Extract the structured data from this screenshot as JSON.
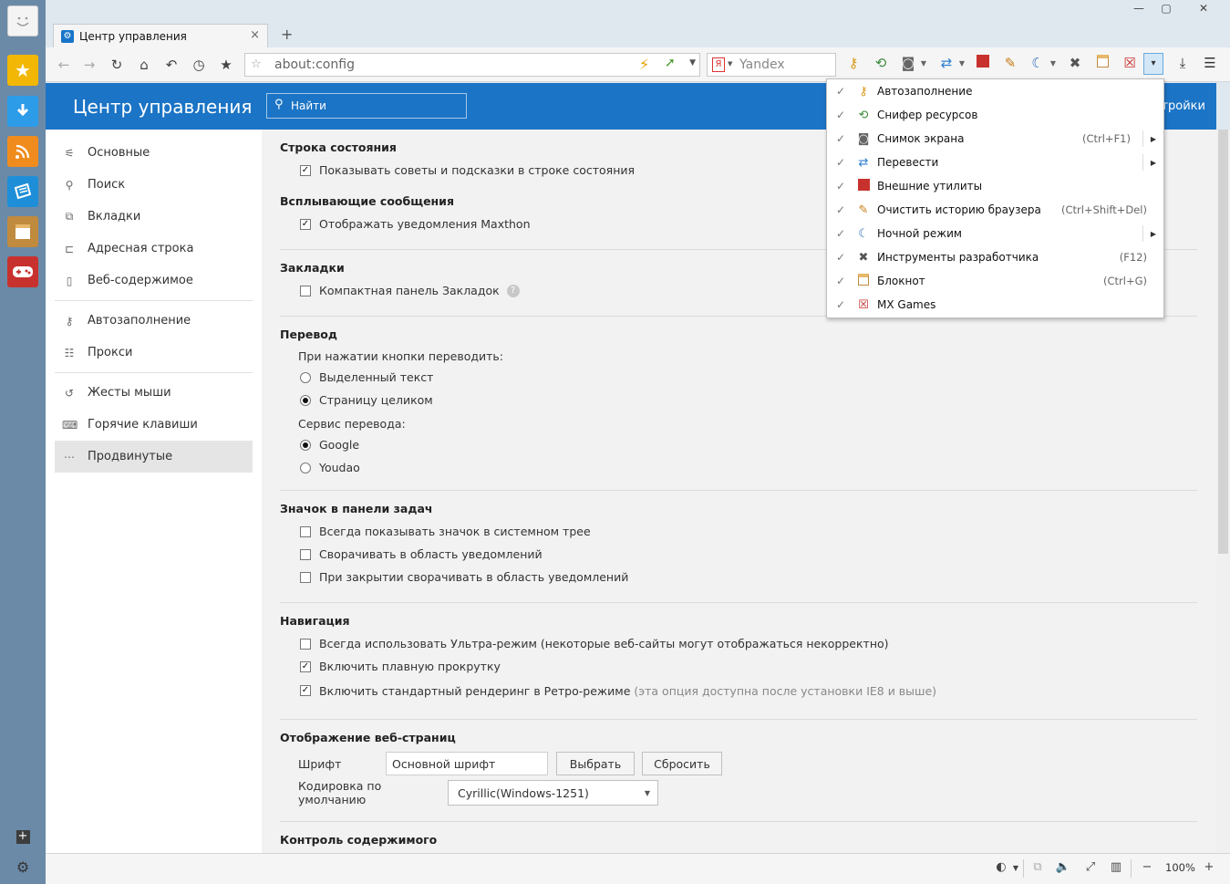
{
  "window": {
    "tab_title": "Центр управления",
    "new_tab": "+",
    "close_tab": "×",
    "minimize": "—",
    "maximize": "▢",
    "close": "✕"
  },
  "toolbar": {
    "url": "about:config",
    "search_engine": "Yandex",
    "search_engine_logo": "Я"
  },
  "header": {
    "title": "Центр управления",
    "search_placeholder": "Найти",
    "right_link": "стройки"
  },
  "nav": {
    "group1": [
      {
        "label": "Основные",
        "icon": "sliders-icon"
      },
      {
        "label": "Поиск",
        "icon": "search-icon"
      },
      {
        "label": "Вкладки",
        "icon": "tabs-icon"
      },
      {
        "label": "Адресная строка",
        "icon": "address-bar-icon"
      },
      {
        "label": "Веб-содержимое",
        "icon": "page-icon"
      }
    ],
    "group2": [
      {
        "label": "Автозаполнение",
        "icon": "key-icon"
      },
      {
        "label": "Прокси",
        "icon": "proxy-icon"
      }
    ],
    "group3": [
      {
        "label": "Жесты мыши",
        "icon": "gesture-icon"
      },
      {
        "label": "Горячие клавиши",
        "icon": "hotkey-icon"
      },
      {
        "label": "Продвинутые",
        "icon": "more-icon",
        "active": true
      }
    ]
  },
  "sections": {
    "status_bar": {
      "title": "Строка состояния",
      "opt1": "Показывать советы и подсказки в строке состояния",
      "opt1_checked": true
    },
    "popups": {
      "title": "Всплывающие сообщения",
      "opt1": "Отображать уведомления Maxthon",
      "opt1_checked": true
    },
    "bookmarks": {
      "title": "Закладки",
      "opt1": "Компактная панель Закладок",
      "opt1_checked": false
    },
    "translate": {
      "title": "Перевод",
      "sub1": "При нажатии кнопки переводить:",
      "r1": "Выделенный текст",
      "r2": "Страницу целиком",
      "sub2": "Сервис перевода:",
      "r3": "Google",
      "r4": "Youdao"
    },
    "tray": {
      "title": "Значок в панели задач",
      "opt1": "Всегда показывать значок в системном трее",
      "opt2": "Сворачивать в область уведомлений",
      "opt3": "При закрытии сворачивать в область уведомлений"
    },
    "navigation": {
      "title": "Навигация",
      "opt1": "Всегда использовать Ультра-режим (некоторые веб-сайты могут отображаться некорректно)",
      "opt2": "Включить плавную прокрутку",
      "opt3": "Включить стандартный рендеринг в Ретро-режиме",
      "opt3_hint": "(эта опция доступна после установки IE8 и выше)"
    },
    "display": {
      "title": "Отображение веб-страниц",
      "font_label": "Шрифт",
      "font_value": "Основной шрифт",
      "choose_btn": "Выбрать",
      "reset_btn": "Сбросить",
      "encoding_label": "Кодировка по умолчанию",
      "encoding_value": "Cyrillic(Windows-1251)"
    },
    "content_control": {
      "title": "Контроль содержимого"
    }
  },
  "menu": {
    "items": [
      {
        "label": "Автозаполнение",
        "icon": "key-icon",
        "shortcut": "",
        "submenu": false
      },
      {
        "label": "Снифер ресурсов",
        "icon": "sniffer-icon",
        "shortcut": "",
        "submenu": false
      },
      {
        "label": "Снимок экрана",
        "icon": "camera-icon",
        "shortcut": "(Ctrl+F1)",
        "submenu": true
      },
      {
        "label": "Перевести",
        "icon": "translate-icon",
        "shortcut": "",
        "submenu": true
      },
      {
        "label": "Внешние утилиты",
        "icon": "external-tools-icon",
        "shortcut": "",
        "submenu": false
      },
      {
        "label": "Очистить историю браузера",
        "icon": "broom-icon",
        "shortcut": "(Ctrl+Shift+Del)",
        "submenu": false
      },
      {
        "label": "Ночной режим",
        "icon": "moon-icon",
        "shortcut": "",
        "submenu": true
      },
      {
        "label": "Инструменты разработчика",
        "icon": "wrench-icon",
        "shortcut": "(F12)",
        "submenu": false
      },
      {
        "label": "Блокнот",
        "icon": "notepad-icon",
        "shortcut": "(Ctrl+G)",
        "submenu": false
      },
      {
        "label": "MX Games",
        "icon": "gamepad-icon",
        "shortcut": "",
        "submenu": false
      }
    ]
  },
  "statusbar": {
    "zoom": "100%",
    "zoom_minus": "−",
    "zoom_plus": "+"
  },
  "colors": {
    "accent": "#1b74c5",
    "sidebar": "#6a8aa8"
  }
}
